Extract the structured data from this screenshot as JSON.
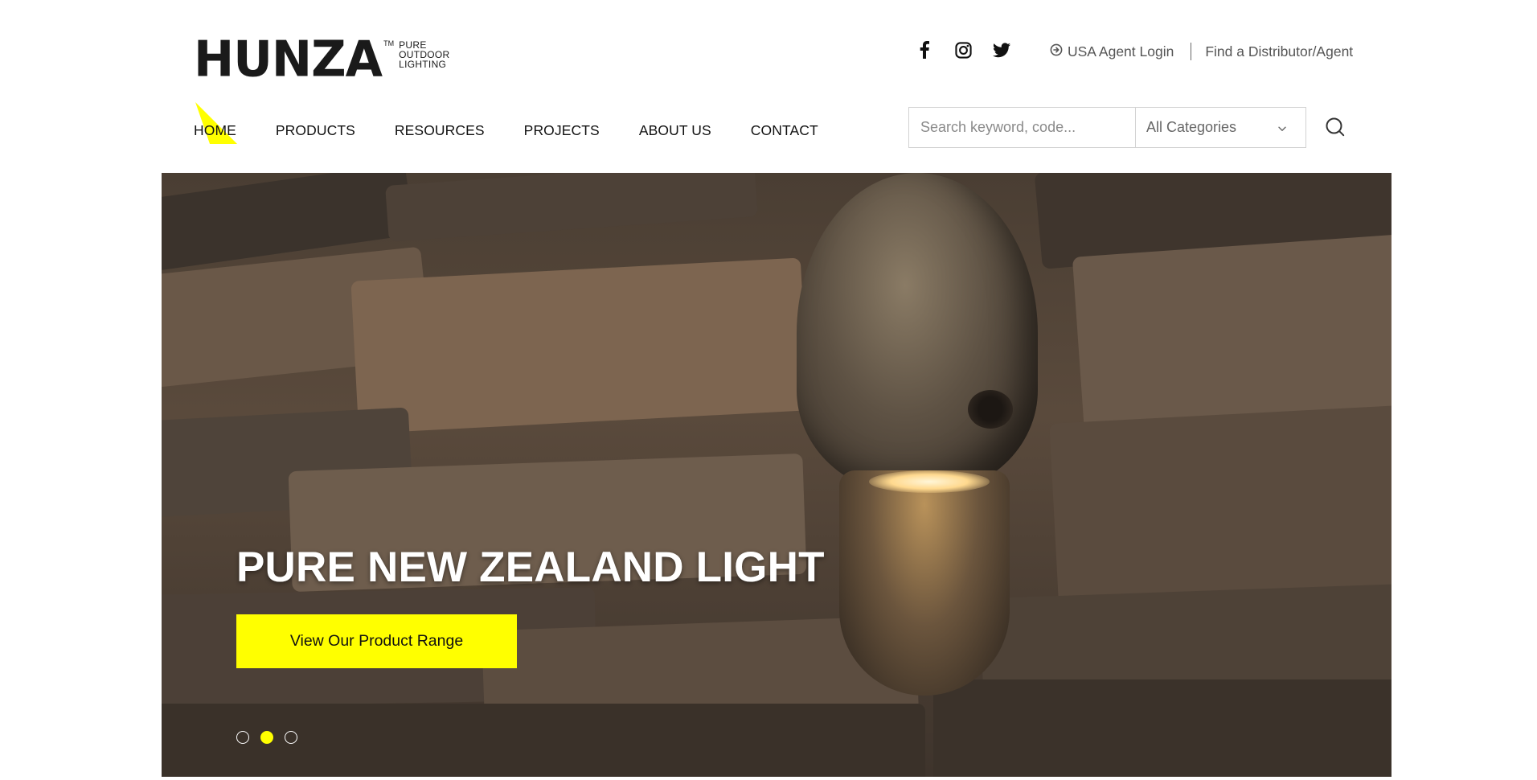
{
  "brand": {
    "name": "HUNZA",
    "trademark": "TM",
    "tagline": [
      "PURE",
      "OUTDOOR",
      "LIGHTING"
    ]
  },
  "social": [
    {
      "icon": "facebook-icon"
    },
    {
      "icon": "instagram-icon"
    },
    {
      "icon": "twitter-icon"
    }
  ],
  "top_links": {
    "agent_login": "USA Agent Login",
    "find_distributor": "Find a Distributor/Agent"
  },
  "nav": {
    "items": [
      "HOME",
      "PRODUCTS",
      "RESOURCES",
      "PROJECTS",
      "ABOUT US",
      "CONTACT"
    ],
    "active": "HOME"
  },
  "search": {
    "placeholder": "Search keyword, code...",
    "value": "",
    "category": "All Categories"
  },
  "hero": {
    "title": "PURE NEW ZEALAND LIGHT",
    "cta": "View Our Product Range",
    "slides": 3,
    "active_slide": 2
  },
  "colors": {
    "accent": "#ffff00",
    "text": "#111111",
    "muted": "#555555",
    "border": "#d2d2d2"
  }
}
